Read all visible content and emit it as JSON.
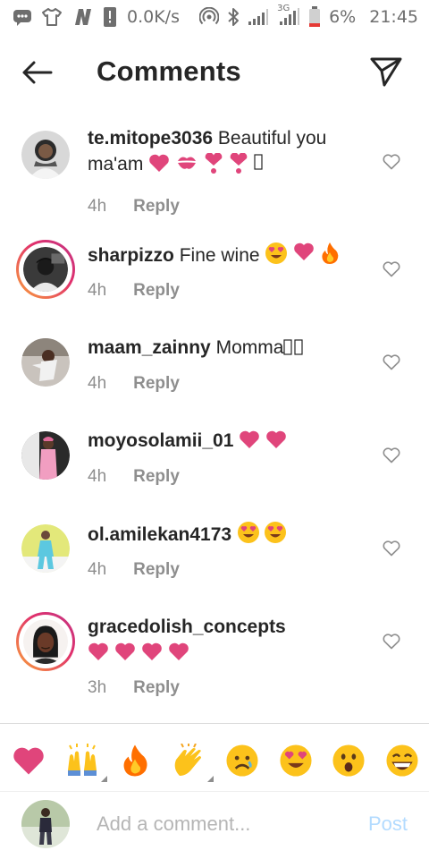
{
  "status_bar": {
    "speed": "0.0K/s",
    "network": "3G",
    "battery": "6%",
    "time": "21:45",
    "icons": [
      "messages-icon",
      "tshirt-icon",
      "n-app-icon",
      "alert-icon",
      "hotspot-icon",
      "bluetooth-icon",
      "signal-icon",
      "signal-3g-icon",
      "battery-icon"
    ]
  },
  "header": {
    "title": "Comments",
    "back_icon": "arrow-left-icon",
    "send_icon": "paper-plane-icon"
  },
  "comments": [
    {
      "username": "te.mitope3036",
      "text": "Beautiful you ma'am",
      "emojis": [
        "heart",
        "kiss-mark",
        "heart-exclamation",
        "heart-exclamation",
        "missing-glyph"
      ],
      "time": "4h",
      "reply": "Reply",
      "ring": false,
      "avatar_color": "#d8d8d8"
    },
    {
      "username": "sharpizzo",
      "text": "Fine wine",
      "emojis": [
        "heart-eyes",
        "heart",
        "fire"
      ],
      "time": "4h",
      "reply": "Reply",
      "ring": true,
      "avatar_color": "#3a3a3a"
    },
    {
      "username": "maam_zainny",
      "text": "Momma",
      "emojis": [
        "missing-glyph",
        "missing-glyph"
      ],
      "time": "4h",
      "reply": "Reply",
      "ring": false,
      "avatar_color": "#c9c3bd"
    },
    {
      "username": "moyosolamii_01",
      "text": "",
      "emojis": [
        "heart",
        "heart"
      ],
      "time": "4h",
      "reply": "Reply",
      "ring": false,
      "avatar_color": "#e9a0b8"
    },
    {
      "username": "ol.amilekan4173",
      "text": "",
      "emojis": [
        "heart-eyes",
        "heart-eyes"
      ],
      "time": "4h",
      "reply": "Reply",
      "ring": false,
      "avatar_color": "#e3e87a"
    },
    {
      "username": "gracedolish_concepts",
      "text": "",
      "emojis": [
        "heart",
        "heart",
        "heart",
        "heart"
      ],
      "time": "3h",
      "reply": "Reply",
      "ring": true,
      "avatar_color": "#5a3a2a"
    }
  ],
  "reactions": [
    "heart",
    "raising-hands",
    "fire",
    "clapping-hands",
    "frowning-face",
    "heart-eyes",
    "surprised-face",
    "grinning-face"
  ],
  "compose": {
    "placeholder": "Add a comment...",
    "post_label": "Post"
  },
  "colors": {
    "heart": "#e0457b",
    "post_disabled": "#b3dbff",
    "ring_start": "#f9a23a",
    "ring_end": "#c13584",
    "meta": "#8e8e8e"
  }
}
